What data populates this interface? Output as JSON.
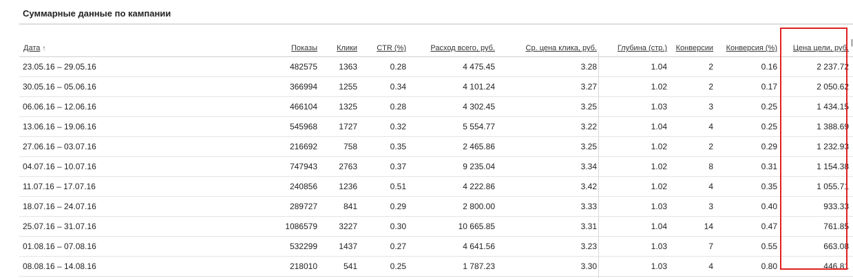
{
  "title": "Суммарные данные по кампании",
  "sort_arrow": "↑",
  "columns": [
    "Дата",
    "Показы",
    "Клики",
    "CTR (%)",
    "Расход всего, руб.",
    "Ср. цена клика, руб.",
    "Глубина (стр.)",
    "Конверсии",
    "Конверсия (%)",
    "Цена цели, руб."
  ],
  "rows": [
    [
      "23.05.16 – 29.05.16",
      "482575",
      "1363",
      "0.28",
      "4 475.45",
      "3.28",
      "1.04",
      "2",
      "0.16",
      "2 237.72"
    ],
    [
      "30.05.16 – 05.06.16",
      "366994",
      "1255",
      "0.34",
      "4 101.24",
      "3.27",
      "1.02",
      "2",
      "0.17",
      "2 050.62"
    ],
    [
      "06.06.16 – 12.06.16",
      "466104",
      "1325",
      "0.28",
      "4 302.45",
      "3.25",
      "1.03",
      "3",
      "0.25",
      "1 434.15"
    ],
    [
      "13.06.16 – 19.06.16",
      "545968",
      "1727",
      "0.32",
      "5 554.77",
      "3.22",
      "1.04",
      "4",
      "0.25",
      "1 388.69"
    ],
    [
      "27.06.16 – 03.07.16",
      "216692",
      "758",
      "0.35",
      "2 465.86",
      "3.25",
      "1.02",
      "2",
      "0.29",
      "1 232.93"
    ],
    [
      "04.07.16 – 10.07.16",
      "747943",
      "2763",
      "0.37",
      "9 235.04",
      "3.34",
      "1.02",
      "8",
      "0.31",
      "1 154.38"
    ],
    [
      "11.07.16 – 17.07.16",
      "240856",
      "1236",
      "0.51",
      "4 222.86",
      "3.42",
      "1.02",
      "4",
      "0.35",
      "1 055.71"
    ],
    [
      "18.07.16 – 24.07.16",
      "289727",
      "841",
      "0.29",
      "2 800.00",
      "3.33",
      "1.03",
      "3",
      "0.40",
      "933.33"
    ],
    [
      "25.07.16 – 31.07.16",
      "1086579",
      "3227",
      "0.30",
      "10 665.85",
      "3.31",
      "1.04",
      "14",
      "0.47",
      "761.85"
    ],
    [
      "01.08.16 – 07.08.16",
      "532299",
      "1437",
      "0.27",
      "4 641.56",
      "3.23",
      "1.03",
      "7",
      "0.55",
      "663.08"
    ],
    [
      "08.08.16 – 14.08.16",
      "218010",
      "541",
      "0.25",
      "1 787.23",
      "3.30",
      "1.03",
      "4",
      "0.80",
      "446.81"
    ]
  ],
  "colors": {
    "highlight": "#e02020",
    "grid": "#e4e4e4"
  }
}
